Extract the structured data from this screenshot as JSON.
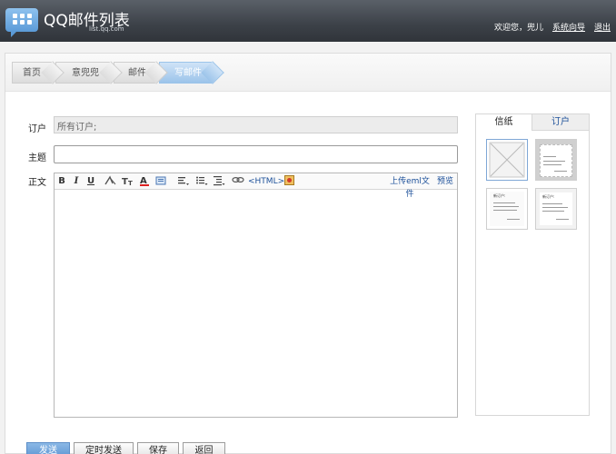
{
  "header": {
    "title": "QQ邮件列表",
    "subtitle": "list.qq.com",
    "welcome": "欢迎您，兜儿",
    "guide": "系统向导",
    "logout": "退出"
  },
  "breadcrumb": [
    "首页",
    "意兜兜",
    "邮件",
    "写邮件"
  ],
  "form": {
    "order_label": "订户",
    "order_value": "所有订户;",
    "subject_label": "主题",
    "subject_value": "",
    "body_label": "正文"
  },
  "toolbar": {
    "bold": "B",
    "italic": "I",
    "underline": "U",
    "html": "<HTML>",
    "upload_eml": "上传eml文件",
    "preview": "预览"
  },
  "templates": {
    "tab_letter": "信纸",
    "tab_order": "订户",
    "thumb_heading": "新订户:"
  },
  "buttons": {
    "send": "发送",
    "scheduled_send": "定时发送",
    "save": "保存",
    "back": "返回"
  },
  "colors": {
    "header_bg": "#3c4148",
    "accent": "#5e95d2",
    "link": "#1b4f99"
  }
}
